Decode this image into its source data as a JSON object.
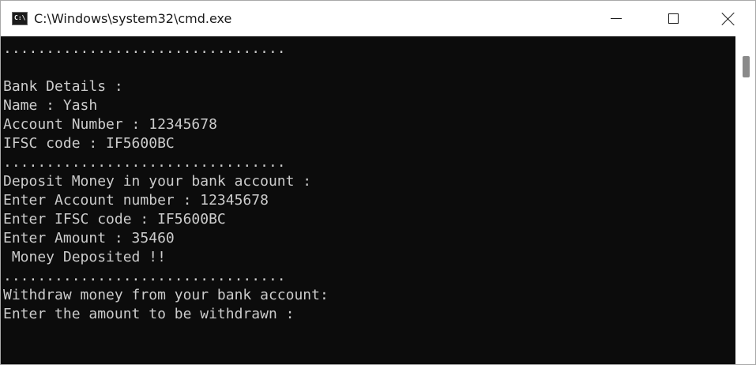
{
  "window": {
    "title": "C:\\Windows\\system32\\cmd.exe",
    "icon_label": "C:\\",
    "icons": {
      "app": "command-prompt-icon",
      "minimize": "minimize-icon",
      "maximize": "maximize-icon",
      "close": "close-icon"
    }
  },
  "console": {
    "lines": [
      ".................................",
      "",
      "Bank Details :",
      "Name : Yash",
      "Account Number : 12345678",
      "IFSC code : IF5600BC",
      ".................................",
      "Deposit Money in your bank account :",
      "Enter Account number : 12345678",
      "Enter IFSC code : IF5600BC",
      "Enter Amount : 35460",
      " Money Deposited !!",
      ".................................",
      "Withdraw money from your bank account:",
      "Enter the amount to be withdrawn :"
    ]
  },
  "colors": {
    "console_background": "#0c0c0c",
    "console_text": "#cccccc",
    "titlebar_background": "#ffffff"
  }
}
